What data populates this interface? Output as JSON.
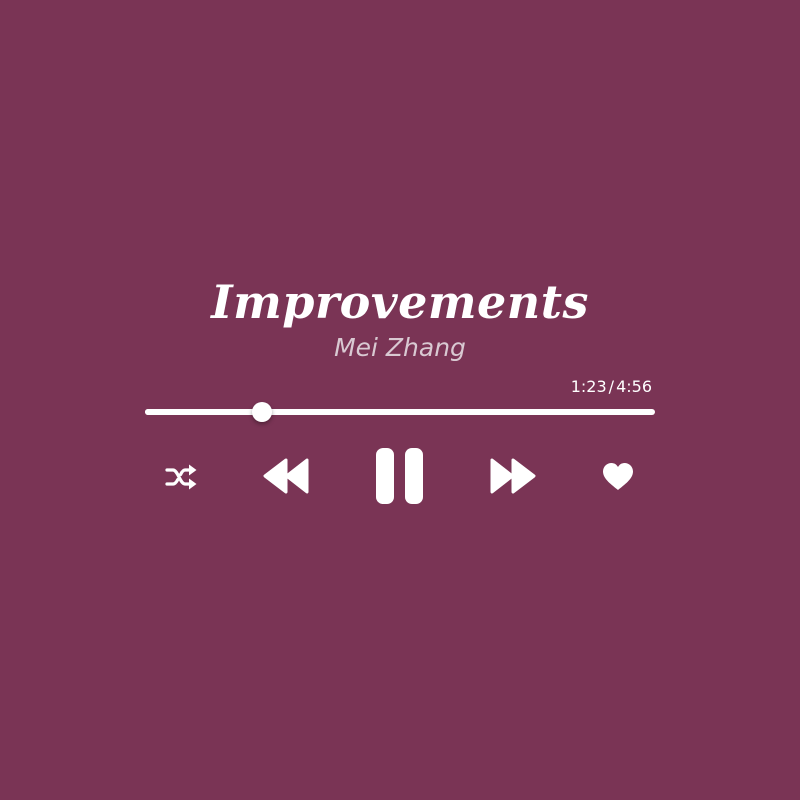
{
  "track": {
    "title": "Improvements",
    "artist": "Mei Zhang"
  },
  "playback": {
    "current_time": "1:23",
    "separator": "/",
    "total_time": "4:56",
    "progress_fraction": 0.23,
    "state": "playing"
  },
  "controls": {
    "shuffle_icon": "shuffle-icon",
    "rewind_icon": "rewind-icon",
    "pause_icon": "pause-icon",
    "forward_icon": "fast-forward-icon",
    "favorite_icon": "heart-icon"
  },
  "colors": {
    "background": "#7a3455",
    "foreground": "#ffffff",
    "artist_text": "#d9c9d2"
  }
}
